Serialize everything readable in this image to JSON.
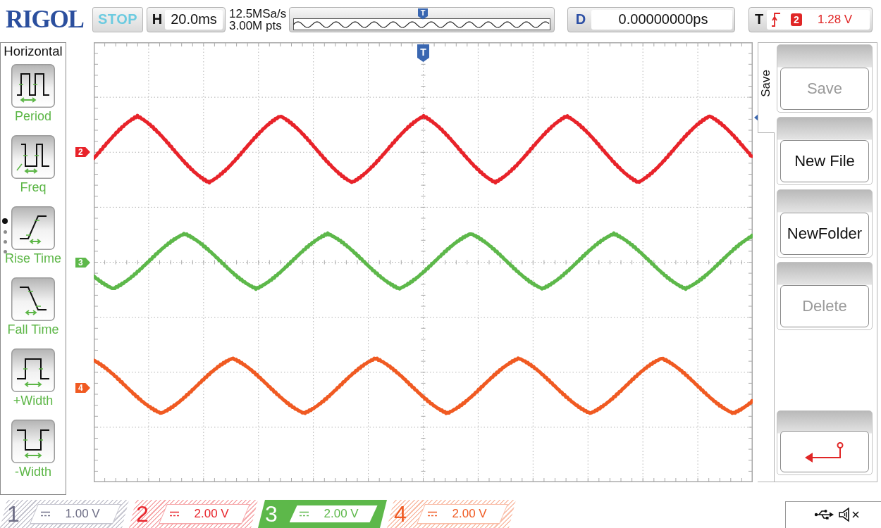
{
  "top_bar": {
    "logo": "RIGOL",
    "run_state": "STOP",
    "timebase": {
      "label": "H",
      "value": "20.0ms"
    },
    "sample_rate": "12.5MSa/s",
    "memory_depth": "3.00M pts",
    "overview_marker": "T",
    "delay": {
      "label": "D",
      "value": "0.00000000ps"
    },
    "trigger": {
      "label": "T",
      "source": "2",
      "level": "1.28 V"
    }
  },
  "measure_menu": {
    "title": "Horizontal",
    "pages": [
      {
        "selected": true
      },
      {
        "selected": false
      },
      {
        "selected": false
      },
      {
        "selected": false
      }
    ],
    "items": [
      {
        "kind": "period",
        "label": "Period"
      },
      {
        "kind": "freq",
        "label": "Freq"
      },
      {
        "kind": "rise",
        "label": "Rise Time"
      },
      {
        "kind": "fall",
        "label": "Fall Time"
      },
      {
        "kind": "pos_width",
        "label": "+Width"
      },
      {
        "kind": "neg_width",
        "label": "-Width"
      }
    ]
  },
  "screen": {
    "trigger_marker": "T",
    "channel_markers": [
      {
        "label": "2",
        "color": "#e8232a"
      },
      {
        "label": "3",
        "color": "#5db84a"
      },
      {
        "label": "4",
        "color": "#f05a22"
      }
    ]
  },
  "save_menu": {
    "title": "Save",
    "softkeys": [
      {
        "kind": "text",
        "label": "Save",
        "disabled": true
      },
      {
        "kind": "text",
        "label": "New File",
        "disabled": false
      },
      {
        "kind": "text",
        "label": "NewFolder",
        "disabled": false
      },
      {
        "kind": "text",
        "label": "Delete",
        "disabled": true
      },
      {
        "kind": "return"
      }
    ]
  },
  "channels": [
    {
      "number": "1",
      "scale": "1.00 V",
      "selected": false,
      "color": "#6e6e86"
    },
    {
      "number": "2",
      "scale": "2.00 V",
      "selected": false,
      "color": "#e8232a"
    },
    {
      "number": "3",
      "scale": "2.00 V",
      "selected": true,
      "color": "#5db84a"
    },
    {
      "number": "4",
      "scale": "2.00 V",
      "selected": false,
      "color": "#f05a22"
    }
  ]
}
